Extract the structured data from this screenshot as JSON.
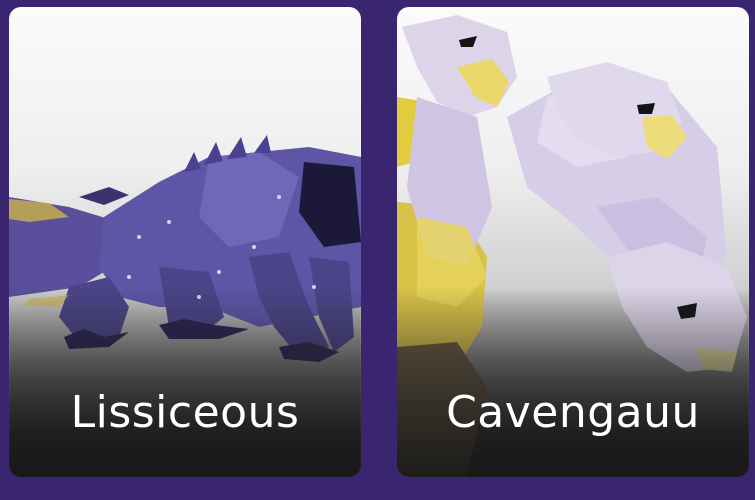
{
  "cards": [
    {
      "name": "Lissiceous",
      "image": "dark-blue-dragon-render"
    },
    {
      "name": "Cavengauu",
      "image": "white-three-headed-griffin-render"
    }
  ],
  "colors": {
    "background": "#3a2670",
    "card_light": "#f5f5f5",
    "card_dark": "#1e1e1e",
    "label": "#ffffff"
  }
}
